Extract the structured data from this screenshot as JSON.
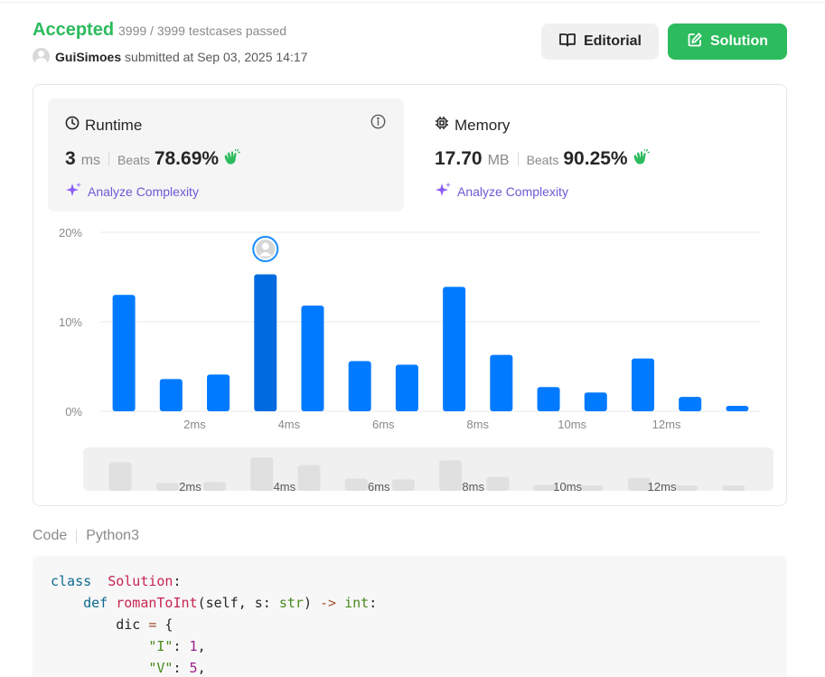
{
  "header": {
    "status": "Accepted",
    "testcases": "3999 / 3999 testcases passed",
    "username": "GuiSimoes",
    "submitted_prefix": "submitted at",
    "submitted_at": "Sep 03, 2025 14:17",
    "editorial_label": "Editorial",
    "solution_label": "Solution"
  },
  "runtime": {
    "title": "Runtime",
    "value": "3",
    "unit": "ms",
    "beats_label": "Beats",
    "beats_pct": "78.69%",
    "analyze_label": "Analyze Complexity"
  },
  "memory": {
    "title": "Memory",
    "value": "17.70",
    "unit": "MB",
    "beats_label": "Beats",
    "beats_pct": "90.25%",
    "analyze_label": "Analyze Complexity"
  },
  "colors": {
    "accent_green": "#2cbb5d",
    "bar_blue": "#007aff",
    "bar_selected": "#006be0",
    "analyze_purple": "#6a5bd6"
  },
  "chart_data": {
    "type": "bar",
    "x": [
      1,
      2,
      3,
      4,
      5,
      6,
      7,
      8,
      9,
      10,
      11,
      12,
      13,
      14
    ],
    "values": [
      13.0,
      3.6,
      4.1,
      15.3,
      11.8,
      5.6,
      5.2,
      13.9,
      6.3,
      2.7,
      2.1,
      5.9,
      1.6,
      0.6
    ],
    "selected_index": 3,
    "x_tick_labels": [
      "2ms",
      "4ms",
      "6ms",
      "8ms",
      "10ms",
      "12ms"
    ],
    "x_tick_positions": [
      2.5,
      4.5,
      6.5,
      8.5,
      10.5,
      12.5
    ],
    "y_tick_labels": [
      "0%",
      "10%",
      "20%"
    ],
    "y_ticks": [
      0,
      10,
      20
    ],
    "ylim": [
      0,
      20
    ],
    "grid": true
  },
  "code": {
    "label": "Code",
    "language": "Python3",
    "lines": [
      [
        [
          "kw",
          "class"
        ],
        [
          "",
          "  "
        ],
        [
          "cls",
          "Solution"
        ],
        [
          "",
          ":"
        ]
      ],
      [
        [
          "",
          "    "
        ],
        [
          "kw",
          "def"
        ],
        [
          "",
          " "
        ],
        [
          "fn",
          "romanToInt"
        ],
        [
          "",
          "(self, s: "
        ],
        [
          "bi",
          "str"
        ],
        [
          "",
          ") "
        ],
        [
          "op",
          "->"
        ],
        [
          "",
          " "
        ],
        [
          "bi",
          "int"
        ],
        [
          "",
          ":"
        ]
      ],
      [
        [
          "",
          "        dic "
        ],
        [
          "op",
          "="
        ],
        [
          "",
          " {"
        ]
      ],
      [
        [
          "",
          "            "
        ],
        [
          "str",
          "\"I\""
        ],
        [
          "",
          ": "
        ],
        [
          "num",
          "1"
        ],
        [
          "",
          ","
        ]
      ],
      [
        [
          "",
          "            "
        ],
        [
          "str",
          "\"V\""
        ],
        [
          "",
          ": "
        ],
        [
          "num",
          "5"
        ],
        [
          "",
          ","
        ]
      ]
    ]
  }
}
